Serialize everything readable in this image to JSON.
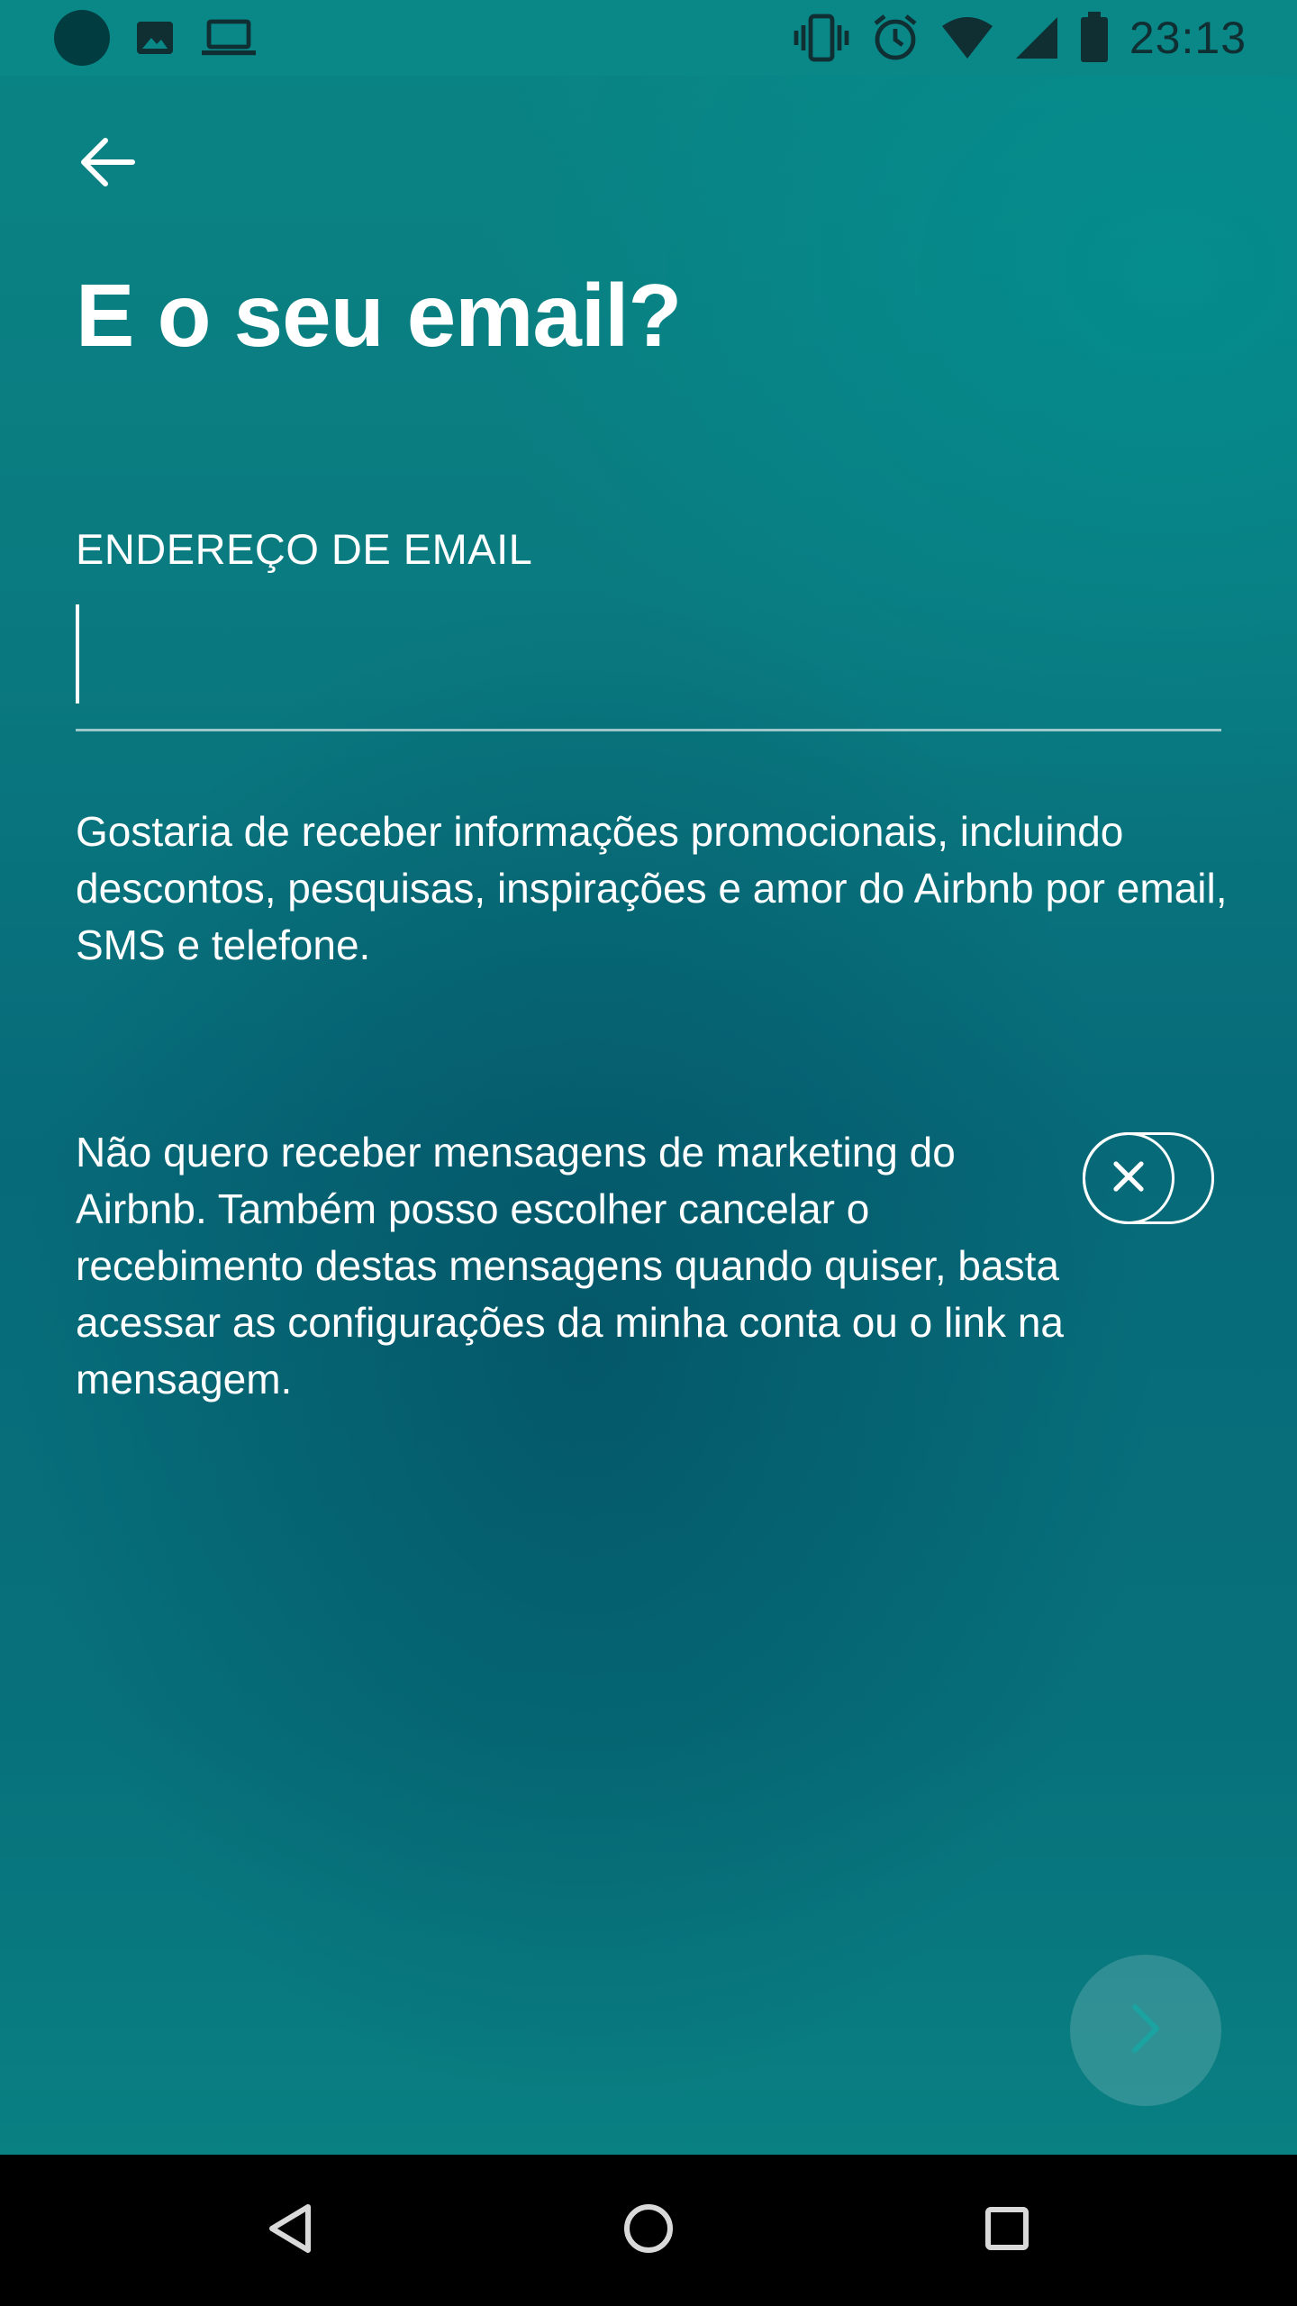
{
  "status_bar": {
    "time": "23:13",
    "left_icons": [
      "notification-dot-icon",
      "image-icon",
      "laptop-icon"
    ],
    "right_icons": [
      "vibrate-icon",
      "alarm-icon",
      "wifi-icon",
      "signal-icon",
      "battery-icon"
    ]
  },
  "header": {
    "back_icon": "arrow-left-icon",
    "title": "E o seu email?"
  },
  "email": {
    "label": "ENDEREÇO DE EMAIL",
    "value": "",
    "placeholder": ""
  },
  "promo": {
    "text": "Gostaria de receber informações promocionais, incluindo descontos, pesquisas, inspirações e amor do Airbnb por email, SMS e telefone."
  },
  "opt_out": {
    "text": "Não quero receber mensagens de marketing do Airbnb. Também posso escolher cancelar o recebimento destas mensagens quando quiser, basta acessar as configurações da minha conta ou o link na mensagem.",
    "toggle_on": false,
    "toggle_icon": "close-icon"
  },
  "next_button": {
    "icon": "chevron-right-icon",
    "enabled": false
  },
  "nav_bar": {
    "icons": [
      "back-triangle-icon",
      "home-circle-icon",
      "recents-square-icon"
    ]
  },
  "colors": {
    "background_top": "#0a8484",
    "background_mid": "#076a79",
    "status_icons": "#0f2f33",
    "text": "#ffffff",
    "nav_bar": "#000000"
  }
}
